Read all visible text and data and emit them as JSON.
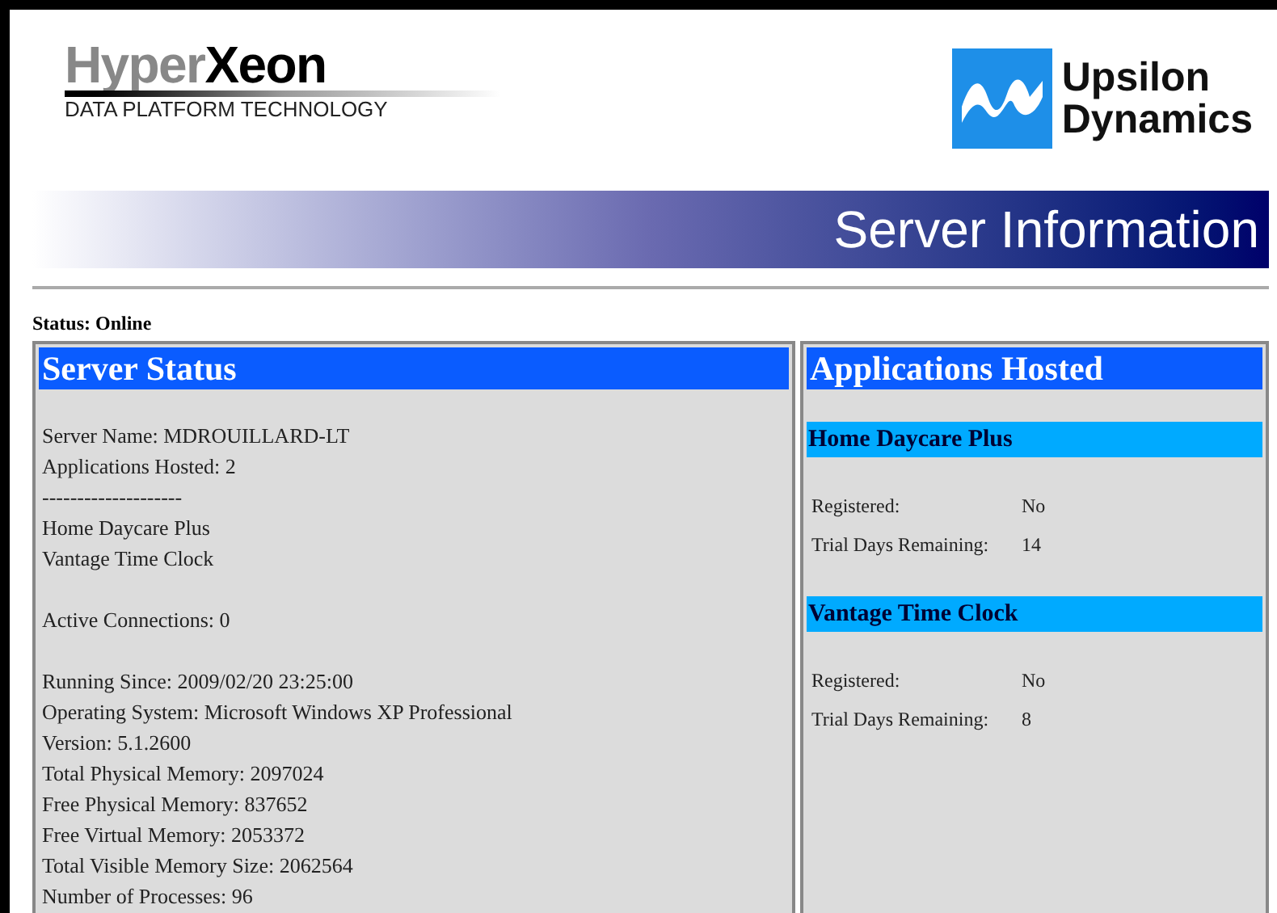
{
  "logo_left": {
    "part_1": "Hyper",
    "part_2": "Xeon",
    "tagline": "DATA PLATFORM TECHNOLOGY"
  },
  "logo_right": {
    "line_1": "Upsilon",
    "line_2": "Dynamics"
  },
  "banner": {
    "title": "Server Information"
  },
  "status": "Status: Online",
  "server_status": {
    "title": "Server Status",
    "groups": [
      [
        "Server Name: MDROUILLARD-LT",
        "Applications Hosted: 2",
        "--------------------",
        "Home Daycare Plus",
        "Vantage Time Clock"
      ],
      [
        "Active Connections: 0"
      ],
      [
        "Running Since: 2009/02/20 23:25:00",
        "Operating System: Microsoft Windows XP Professional",
        "Version: 5.1.2600",
        "Total Physical Memory: 2097024",
        "Free Physical Memory: 837652",
        "Free Virtual Memory: 2053372",
        "Total Visible Memory Size: 2062564",
        "Number of Processes: 96"
      ]
    ]
  },
  "applications": {
    "title": "Applications Hosted",
    "items": [
      {
        "name": "Home Daycare Plus",
        "rows": [
          {
            "label": "Registered:",
            "value": "No"
          },
          {
            "label": "Trial Days Remaining:",
            "value": "14"
          }
        ]
      },
      {
        "name": "Vantage Time Clock",
        "rows": [
          {
            "label": "Registered:",
            "value": "No"
          },
          {
            "label": "Trial Days Remaining:",
            "value": "8"
          }
        ]
      }
    ]
  }
}
